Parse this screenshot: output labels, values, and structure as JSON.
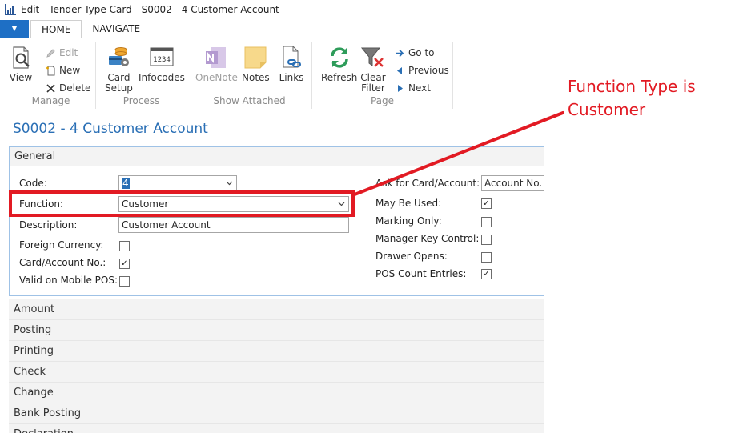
{
  "window": {
    "title": "Edit - Tender Type Card - S0002 - 4 Customer Account"
  },
  "tabs": {
    "file_glyph": "▼",
    "home": "HOME",
    "navigate": "NAVIGATE"
  },
  "ribbon": {
    "manage": {
      "label": "Manage",
      "view": "View",
      "edit": "Edit",
      "new": "New",
      "delete": "Delete"
    },
    "process": {
      "label": "Process",
      "card_setup_1": "Card",
      "card_setup_2": "Setup",
      "infocodes": "Infocodes"
    },
    "show_attached": {
      "label": "Show Attached",
      "onenote": "OneNote",
      "notes": "Notes",
      "links": "Links"
    },
    "page": {
      "label": "Page",
      "refresh": "Refresh",
      "clear_filter_1": "Clear",
      "clear_filter_2": "Filter",
      "goto": "Go to",
      "previous": "Previous",
      "next": "Next"
    },
    "infocodes_icon_text": "1234"
  },
  "page_title": "S0002 - 4 Customer Account",
  "general": {
    "header": "General",
    "code_label": "Code:",
    "code_value": "4",
    "function_label": "Function:",
    "function_value": "Customer",
    "description_label": "Description:",
    "description_value": "Customer Account",
    "foreign_currency_label": "Foreign Currency:",
    "card_account_no_label": "Card/Account No.:",
    "valid_mobile_pos_label": "Valid on Mobile POS:",
    "ask_card_account_label": "Ask for Card/Account:",
    "ask_card_account_value": "Account No.",
    "may_be_used_label": "May Be Used:",
    "marking_only_label": "Marking Only:",
    "manager_key_control_label": "Manager Key Control:",
    "drawer_opens_label": "Drawer Opens:",
    "pos_count_entries_label": "POS Count Entries:",
    "checked_glyph": "✓",
    "checkboxes": {
      "foreign_currency": false,
      "card_account_no": true,
      "valid_mobile_pos": false,
      "may_be_used": true,
      "marking_only": false,
      "manager_key_control": false,
      "drawer_opens": false,
      "pos_count_entries": true
    }
  },
  "sections": [
    "Amount",
    "Posting",
    "Printing",
    "Check",
    "Change",
    "Bank Posting",
    "Declaration"
  ],
  "annotation": {
    "line1": "Function Type is",
    "line2": "Customer"
  },
  "colors": {
    "accent": "#2a6fb5",
    "annotation": "#e21a23",
    "file_tab": "#1e6fc5"
  }
}
